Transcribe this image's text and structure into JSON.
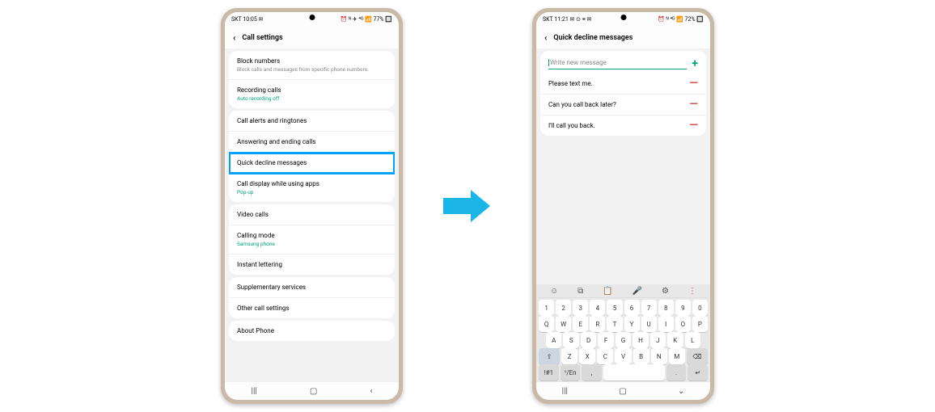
{
  "phone1": {
    "status_left": "SKT 10:05 ✉",
    "status_right": "⏰ ᴺ ✈  ⁴ᴳ 📶 77% 🔲",
    "title": "Call settings",
    "groups": [
      {
        "items": [
          {
            "label": "Block numbers",
            "sub": "Block calls and messages from specific phone numbers.",
            "green": false
          },
          {
            "label": "Recording calls",
            "sub": "Auto recording off",
            "green": true
          }
        ]
      },
      {
        "items": [
          {
            "label": "Call alerts and ringtones"
          },
          {
            "label": "Answering and ending calls"
          },
          {
            "label": "Quick decline messages",
            "highlight": true
          },
          {
            "label": "Call display while using apps",
            "sub": "Pop-up",
            "green": true
          }
        ]
      },
      {
        "items": [
          {
            "label": "Video calls"
          },
          {
            "label": "Calling mode",
            "sub": "Samsung phone",
            "green": true
          },
          {
            "label": "Instant lettering"
          }
        ]
      },
      {
        "items": [
          {
            "label": "Supplementary services"
          },
          {
            "label": "Other call settings"
          }
        ]
      },
      {
        "items": [
          {
            "label": "About Phone"
          }
        ]
      }
    ]
  },
  "phone2": {
    "status_left": "SKT 11:21 ✉ ⊙ ≡ ✉",
    "status_right": "⏰ ᴺ ⁴ᴳ 📶 72% 🔲",
    "title": "Quick decline messages",
    "input_placeholder": "Write new message",
    "messages": [
      "Please text me.",
      "Can you call back later?",
      "I'll call you back."
    ],
    "keyboard": {
      "toolbar": [
        "☺",
        "⧉",
        "📋",
        "🎤",
        "⚙",
        "⋮"
      ],
      "rows": [
        [
          "1",
          "2",
          "3",
          "4",
          "5",
          "6",
          "7",
          "8",
          "9",
          "0"
        ],
        [
          "Q",
          "W",
          "E",
          "R",
          "T",
          "Y",
          "U",
          "I",
          "O",
          "P"
        ],
        [
          "A",
          "S",
          "D",
          "F",
          "G",
          "H",
          "J",
          "K",
          "L"
        ],
        [
          "⇧",
          "Z",
          "X",
          "C",
          "V",
          "B",
          "N",
          "M",
          "⌫"
        ],
        [
          "!#1",
          "¹/En",
          ",",
          "space",
          ".",
          "↵"
        ]
      ]
    }
  }
}
